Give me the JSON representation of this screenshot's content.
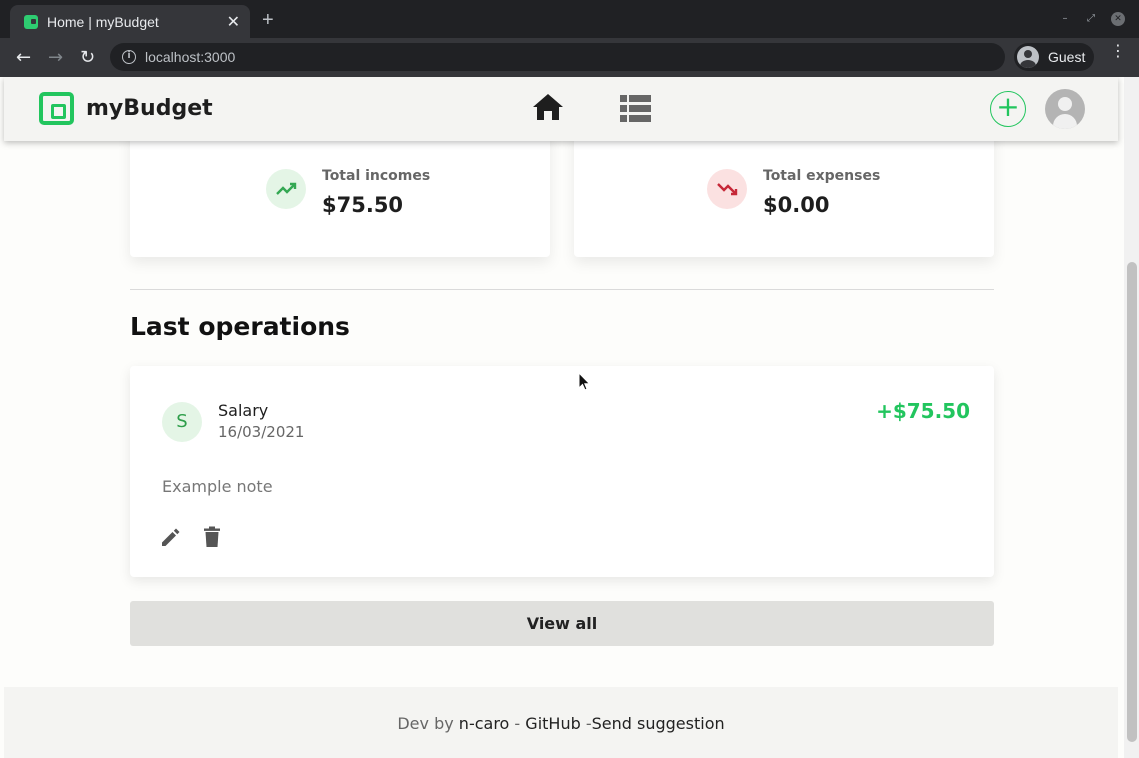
{
  "browser": {
    "tab_title": "Home | myBudget",
    "url": "localhost:3000",
    "profile_label": "Guest"
  },
  "header": {
    "brand": "myBudget",
    "accent_color": "#22c55e"
  },
  "summary": {
    "income": {
      "label": "Total incomes",
      "value": "$75.50",
      "icon": "trending-up-icon"
    },
    "expense": {
      "label": "Total expenses",
      "value": "$0.00",
      "icon": "trending-down-icon"
    }
  },
  "operations": {
    "title": "Last operations",
    "items": [
      {
        "avatar_letter": "S",
        "name": "Salary",
        "date": "16/03/2021",
        "amount": "+$75.50",
        "note": "Example note"
      }
    ],
    "view_all_label": "View all"
  },
  "footer": {
    "prefix": "Dev by",
    "author": "n-caro",
    "sep1": "-",
    "github": "GitHub",
    "sep2": "-",
    "suggestion": "Send suggestion"
  }
}
